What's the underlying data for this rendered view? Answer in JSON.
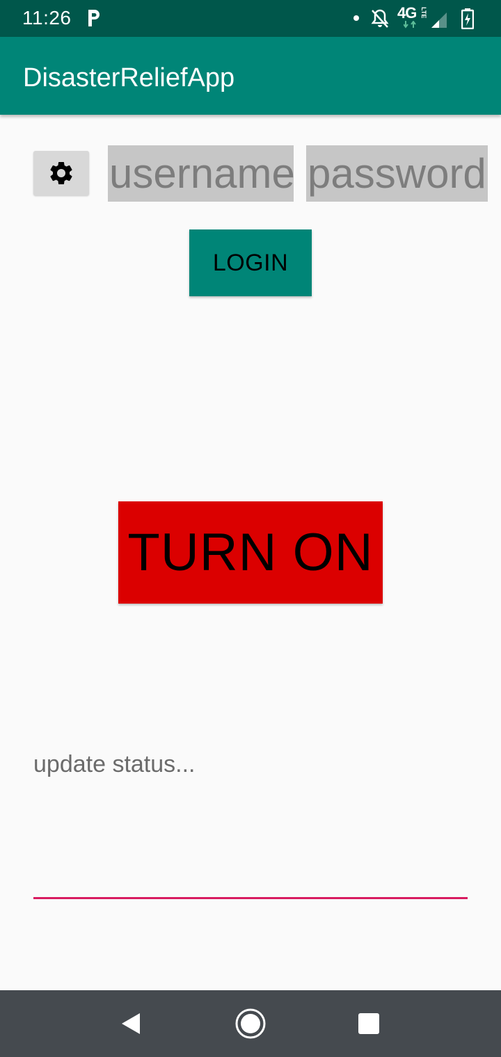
{
  "status_bar": {
    "time": "11:26",
    "carrier_icon": "p-app-icon",
    "network": "4G",
    "network_sub": "LTE",
    "icons": [
      "dot-icon",
      "bell-off-icon",
      "signal-icon",
      "battery-charging-icon"
    ]
  },
  "app_bar": {
    "title": "DisasterReliefApp"
  },
  "login": {
    "settings_icon": "gear-icon",
    "username_placeholder": "username",
    "password_placeholder": "password",
    "login_label": "LOGIN"
  },
  "main": {
    "toggle_label": "TURN ON",
    "toggle_color": "#db0000"
  },
  "status_update": {
    "placeholder": "update status...",
    "underline_color": "#d81b60"
  },
  "nav_bar": {
    "icons": [
      "back-icon",
      "home-icon",
      "recents-icon"
    ]
  },
  "colors": {
    "primary": "#008577",
    "primary_dark": "#00574b",
    "accent": "#d81b60"
  }
}
